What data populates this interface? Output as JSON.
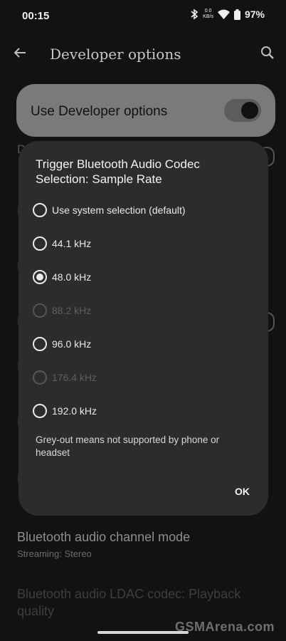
{
  "status_bar": {
    "time": "00:15",
    "net_speed_value": "0.0",
    "net_speed_unit": "KB/s",
    "battery": "97%"
  },
  "app_bar": {
    "title": "Developer options"
  },
  "main_toggle": {
    "label": "Use Developer options",
    "enabled": true
  },
  "dialog": {
    "title": "Trigger Bluetooth Audio Codec Selection: Sample Rate",
    "options": [
      {
        "label": "Use system selection (default)",
        "checked": false,
        "disabled": false
      },
      {
        "label": "44.1 kHz",
        "checked": false,
        "disabled": false
      },
      {
        "label": "48.0 kHz",
        "checked": true,
        "disabled": false
      },
      {
        "label": "88.2 kHz",
        "checked": false,
        "disabled": true
      },
      {
        "label": "96.0 kHz",
        "checked": false,
        "disabled": false
      },
      {
        "label": "176.4 kHz",
        "checked": false,
        "disabled": true
      },
      {
        "label": "192.0 kHz",
        "checked": false,
        "disabled": false
      }
    ],
    "note": "Grey-out means not supported by phone or headset",
    "ok_label": "OK"
  },
  "background_list": {
    "channel_mode_title": "Bluetooth audio channel mode",
    "channel_mode_sub": "Streaming: Stereo",
    "ldac_title": "Bluetooth audio LDAC codec: Playback quality"
  },
  "watermark": "GSMArena.com",
  "colors": {
    "dialog_bg": "#2c2c2c",
    "toggle_card": "#7a7a7a",
    "page_bg": "#121212"
  }
}
